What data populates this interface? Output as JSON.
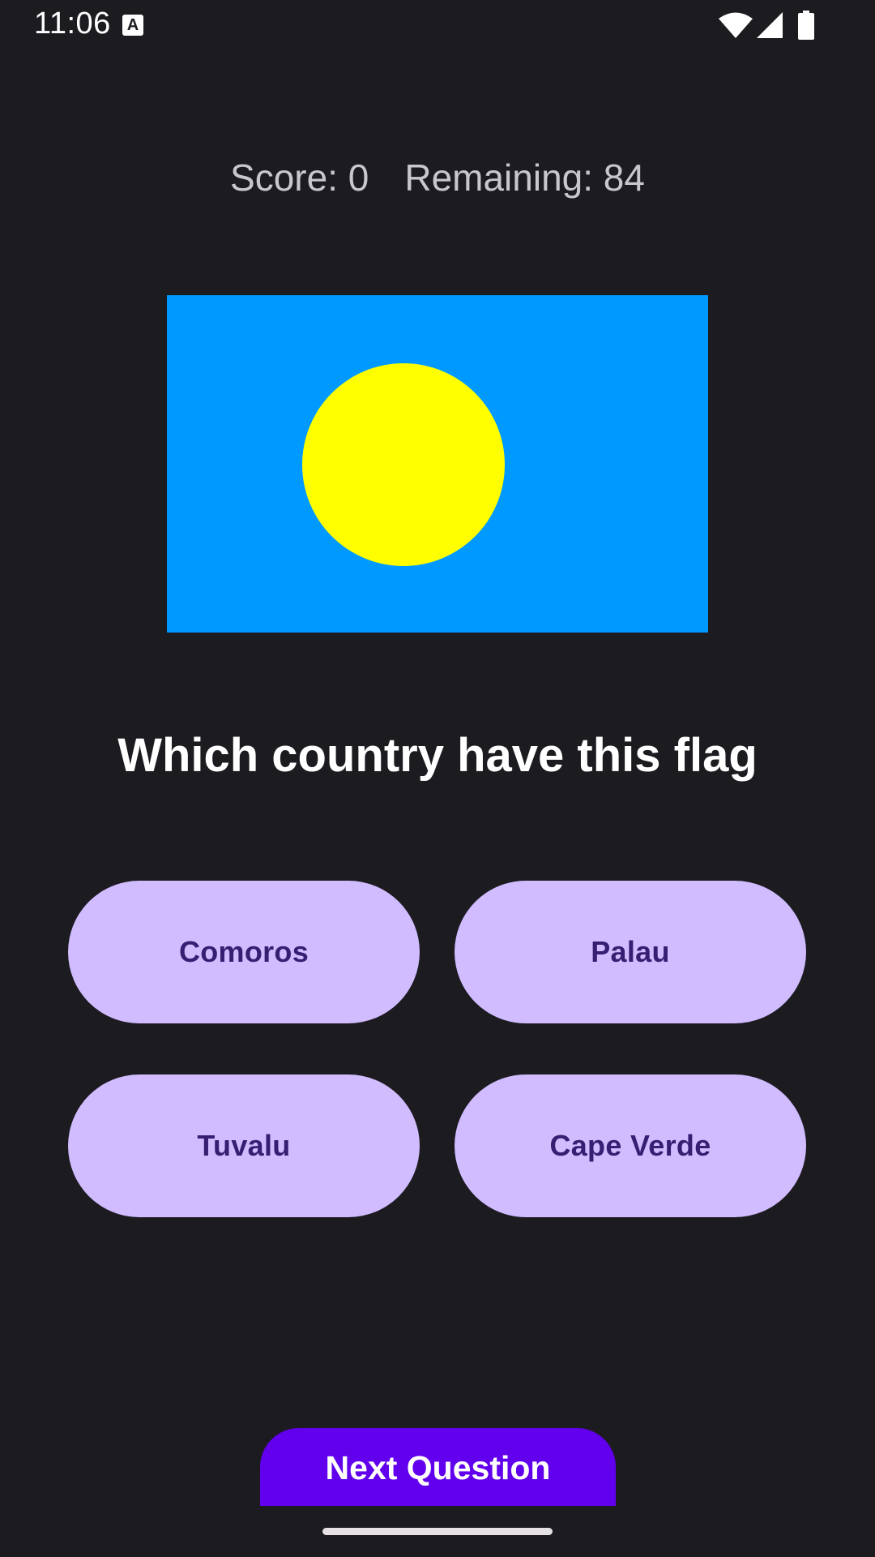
{
  "status_bar": {
    "time": "11:06",
    "notification_icon": "a-keyboard-icon",
    "icons": [
      "wifi-icon",
      "cell-signal-icon",
      "battery-icon"
    ]
  },
  "score": {
    "score_text": "Score: 0",
    "remaining_text": "Remaining: 84"
  },
  "flag": {
    "icon": "flag-of-palau",
    "background_color": "#0099ff",
    "sun_color": "#ffff00"
  },
  "question": "Which country have this flag",
  "answers": [
    "Comoros",
    "Palau",
    "Tuvalu",
    "Cape Verde"
  ],
  "next_button_label": "Next Question",
  "colors": {
    "background": "#1c1b20",
    "answer_button_bg": "#d0bcff",
    "answer_button_text": "#381e72",
    "primary": "#6200ee"
  }
}
